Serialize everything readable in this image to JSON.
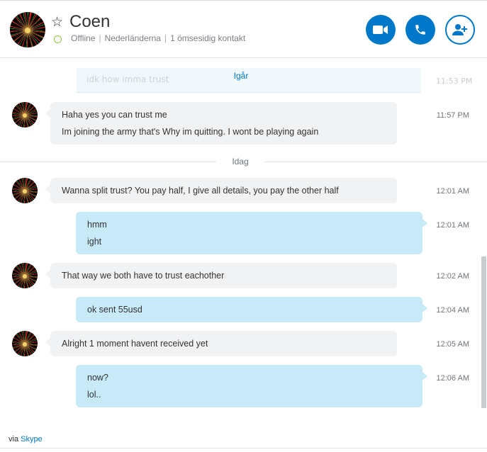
{
  "contact": {
    "name": "Coen",
    "status": "Offline",
    "location": "Nederländerna",
    "mutual": "1 ömsesidig kontakt"
  },
  "buttons": {
    "video_icon": "video-camera-icon",
    "call_icon": "phone-icon",
    "add_icon": "add-person-icon"
  },
  "colors": {
    "accent": "#0078ca",
    "incoming_bubble": "#f0f2f4",
    "outgoing_bubble": "#c7e9f8",
    "status_offline": "#8cc63e"
  },
  "chat": {
    "ghost_message": "idk how imma trust",
    "ghost_time": "11:53 PM",
    "day_yesterday": "Igår",
    "day_today": "Idag",
    "messages": [
      {
        "direction": "in",
        "lines": [
          "Haha yes you can trust me",
          "Im joining the army that's Why im quitting. I wont be playing again"
        ],
        "time": "11:57 PM"
      },
      {
        "direction": "in",
        "lines": [
          "Wanna split trust? You pay half, I give all details, you pay the other half"
        ],
        "time": "12:01 AM"
      },
      {
        "direction": "out",
        "lines": [
          "hmm",
          "ight"
        ],
        "time": "12:01 AM"
      },
      {
        "direction": "in",
        "lines": [
          "That way we both have to trust eachother"
        ],
        "time": "12:02 AM"
      },
      {
        "direction": "out",
        "lines": [
          "ok sent 55usd"
        ],
        "time": "12:04 AM"
      },
      {
        "direction": "in",
        "lines": [
          "Alright 1 moment havent received yet"
        ],
        "time": "12:05 AM"
      },
      {
        "direction": "out",
        "lines": [
          "now?",
          "lol.."
        ],
        "time": "12:06 AM"
      }
    ]
  },
  "footer": {
    "via": "via",
    "skype": "Skype"
  }
}
